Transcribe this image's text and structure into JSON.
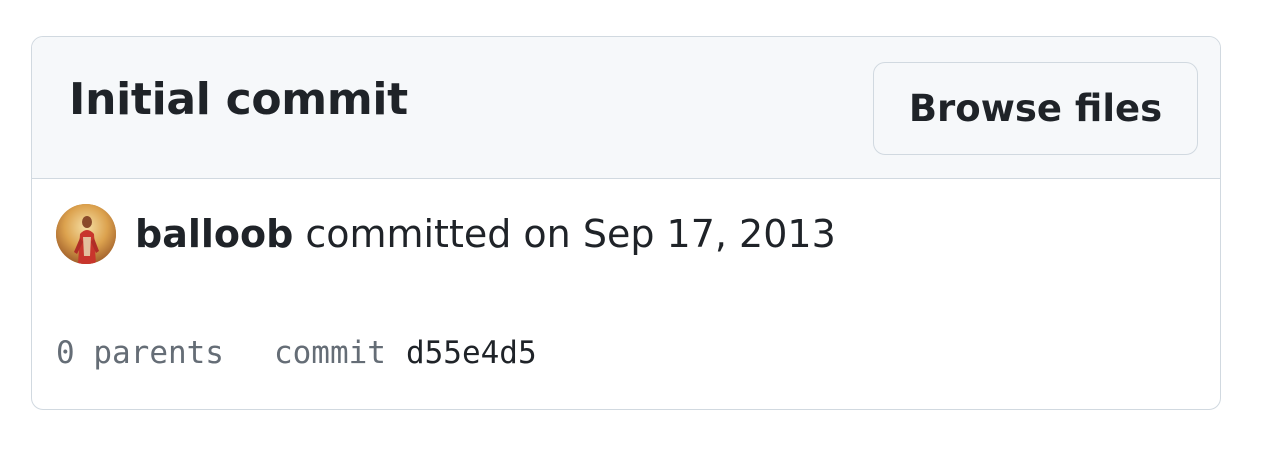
{
  "commit": {
    "title": "Initial commit",
    "browse_files_label": "Browse files",
    "author": "balloob",
    "committed_text": "committed on Sep 17, 2013",
    "parents_text": "0 parents",
    "commit_label": "commit",
    "sha": "d55e4d5"
  },
  "colors": {
    "header_bg": "#f6f8fa",
    "border": "#d1d9e0",
    "text": "#1f2328",
    "muted": "#656d76"
  },
  "icons": {
    "avatar": "user-avatar"
  }
}
